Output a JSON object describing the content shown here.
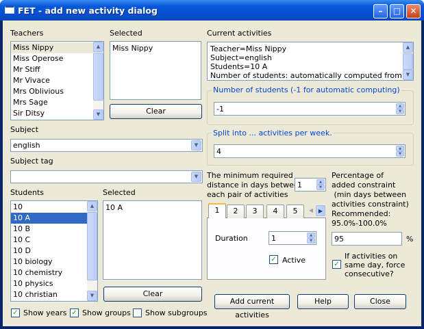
{
  "window": {
    "title": "FET - add new activity dialog"
  },
  "teachers": {
    "label": "Teachers",
    "items": [
      "Miss Nippy",
      "Miss Operose",
      "Mr Stiff",
      "Mr Vivace",
      "Mrs Oblivious",
      "Mrs Sage",
      "Sir Ditsy"
    ],
    "selected_label": "Selected",
    "selected_items": [
      "Miss Nippy"
    ],
    "clear_label": "Clear"
  },
  "subject": {
    "label": "Subject",
    "value": "english"
  },
  "subject_tag": {
    "label": "Subject tag",
    "value": ""
  },
  "students": {
    "label": "Students",
    "items": [
      "10",
      "10 A",
      "10 B",
      "10 C",
      "10 D",
      "10 biology",
      "10 chemistry",
      "10 physics",
      "10 christian"
    ],
    "selected_label": "Selected",
    "selected_items": [
      "10 A"
    ],
    "clear_label": "Clear"
  },
  "checkboxes": {
    "show_years": "Show years",
    "show_groups": "Show groups",
    "show_subgroups": "Show subgroups"
  },
  "current_activities": {
    "label": "Current activities",
    "lines": [
      "Teacher=Miss Nippy",
      "Subject=english",
      "Students=10 A",
      "Number of students: automatically computed from"
    ]
  },
  "num_students": {
    "title": "Number of students (-1 for automatic computing)",
    "value": "-1"
  },
  "split": {
    "title": "Split into ... activities per week.",
    "value": "4"
  },
  "min_days": {
    "label_lines": [
      "The minimum required",
      "distance in days between",
      "each pair of activities"
    ],
    "value": "1"
  },
  "percentage": {
    "label_lines": [
      "Percentage of",
      "added constraint",
      " (min days between",
      "activities constraint)",
      "Recommended:",
      "95.0%-100.0%"
    ],
    "value": "95",
    "unit": "%"
  },
  "tabs": {
    "items": [
      "1",
      "2",
      "3",
      "4",
      "5"
    ],
    "duration_label": "Duration",
    "duration_value": "1",
    "active_label": "Active"
  },
  "force": {
    "label_lines": [
      "If activities on",
      "same day, force",
      "consecutive?"
    ]
  },
  "buttons": {
    "add": "Add current activities",
    "help": "Help",
    "close": "Close"
  }
}
